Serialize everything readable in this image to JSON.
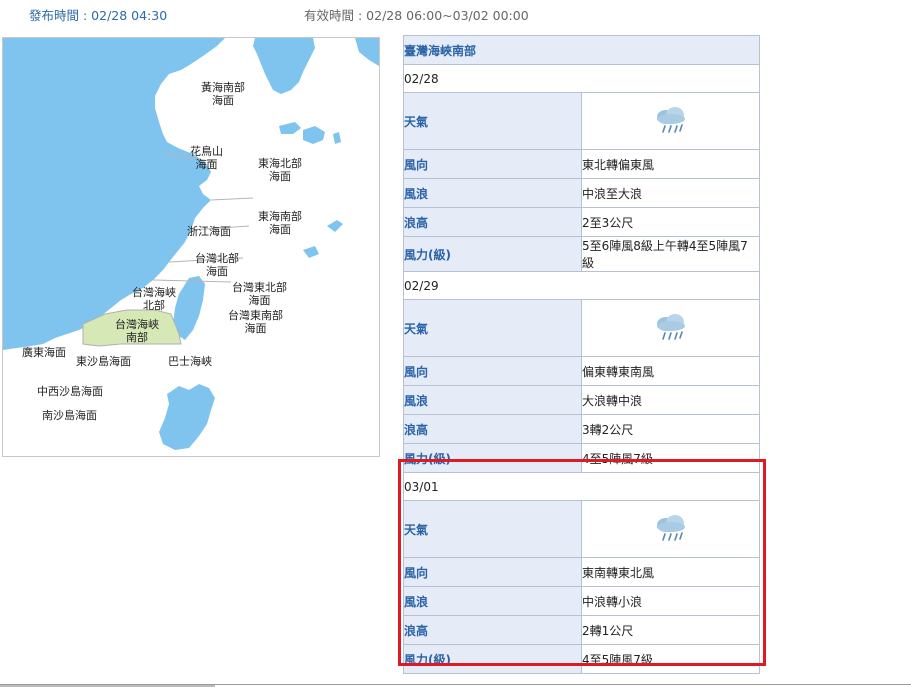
{
  "header": {
    "publish_time": "發布時間 : 02/28 04:30",
    "valid_time": "有效時間 : 02/28 06:00~03/02 00:00"
  },
  "map": {
    "labels": {
      "yellow_sea_south": "黃海南部\n海面",
      "huaniaoshan": "花鳥山\n海面",
      "east_sea_north": "東海北部\n海面",
      "east_sea_south": "東海南部\n海面",
      "zhejiang": "浙江海面",
      "taiwan_north": "台灣北部\n海面",
      "strait_north": "台灣海峽\n北部",
      "strait_south": "台灣海峽\n南部",
      "taiwan_ne": "台灣東北部\n海面",
      "taiwan_se": "台灣東南部\n海面",
      "guangdong": "廣東海面",
      "dongsha": "東沙島海面",
      "bashi": "巴士海峽",
      "central_west_sha": "中西沙島海面",
      "nansha": "南沙島海面"
    },
    "colors": {
      "sea": "#ffffff",
      "land": "#7ec4ee",
      "highlight": "#d6e8b6"
    }
  },
  "forecast": {
    "region": "臺灣海峽南部",
    "field_labels": {
      "weather": "天氣",
      "wind_dir": "風向",
      "wave": "風浪",
      "wave_height": "浪高",
      "wind_force": "風力(級)"
    },
    "days": [
      {
        "date": "02/28",
        "weather_icon": "rain-cloud-icon",
        "wind_dir": "東北轉偏東風",
        "wave": "中浪至大浪",
        "wave_height": "2至3公尺",
        "wind_force": "5至6陣風8級上午轉4至5陣風7級"
      },
      {
        "date": "02/29",
        "weather_icon": "rain-cloud-icon",
        "wind_dir": "偏東轉東南風",
        "wave": "大浪轉中浪",
        "wave_height": "3轉2公尺",
        "wind_force": "4至5陣風7級"
      },
      {
        "date": "03/01",
        "weather_icon": "rain-cloud-icon",
        "wind_dir": "東南轉東北風",
        "wave": "中浪轉小浪",
        "wave_height": "2轉1公尺",
        "wind_force": "4至5陣風7級"
      }
    ],
    "highlight_color": "#e01a22"
  }
}
